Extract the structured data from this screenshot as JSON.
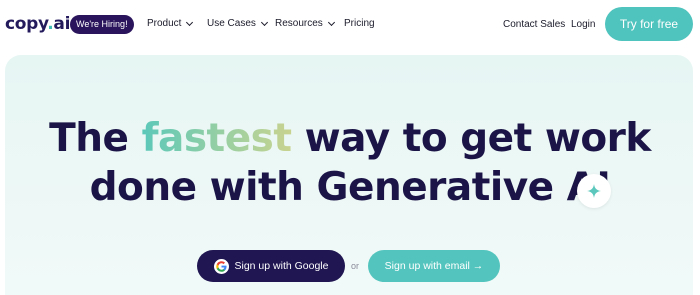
{
  "nav": {
    "logo_text": "copy",
    "logo_dot": ".",
    "logo_suffix": "ai",
    "hiring_badge": "We're Hiring!",
    "menu": [
      {
        "label": "Product"
      },
      {
        "label": "Use Cases"
      },
      {
        "label": "Resources"
      },
      {
        "label": "Pricing"
      }
    ],
    "contact_sales": "Contact Sales",
    "login": "Login",
    "try_free": "Try for free"
  },
  "hero": {
    "headline_part1": "The ",
    "headline_highlight": "fastest",
    "headline_part2": " way to get work",
    "headline_line2": "done with Generative AI",
    "google_button": "Sign up with Google",
    "or_text": "or",
    "email_button": "Sign up with email →"
  },
  "colors": {
    "brand_dark": "#1f1652",
    "accent_teal": "#4fc3bd",
    "hero_bg": "#e6f6f3"
  },
  "icons": [
    "chevron-down-icon",
    "google-icon",
    "sparkle-icon"
  ]
}
